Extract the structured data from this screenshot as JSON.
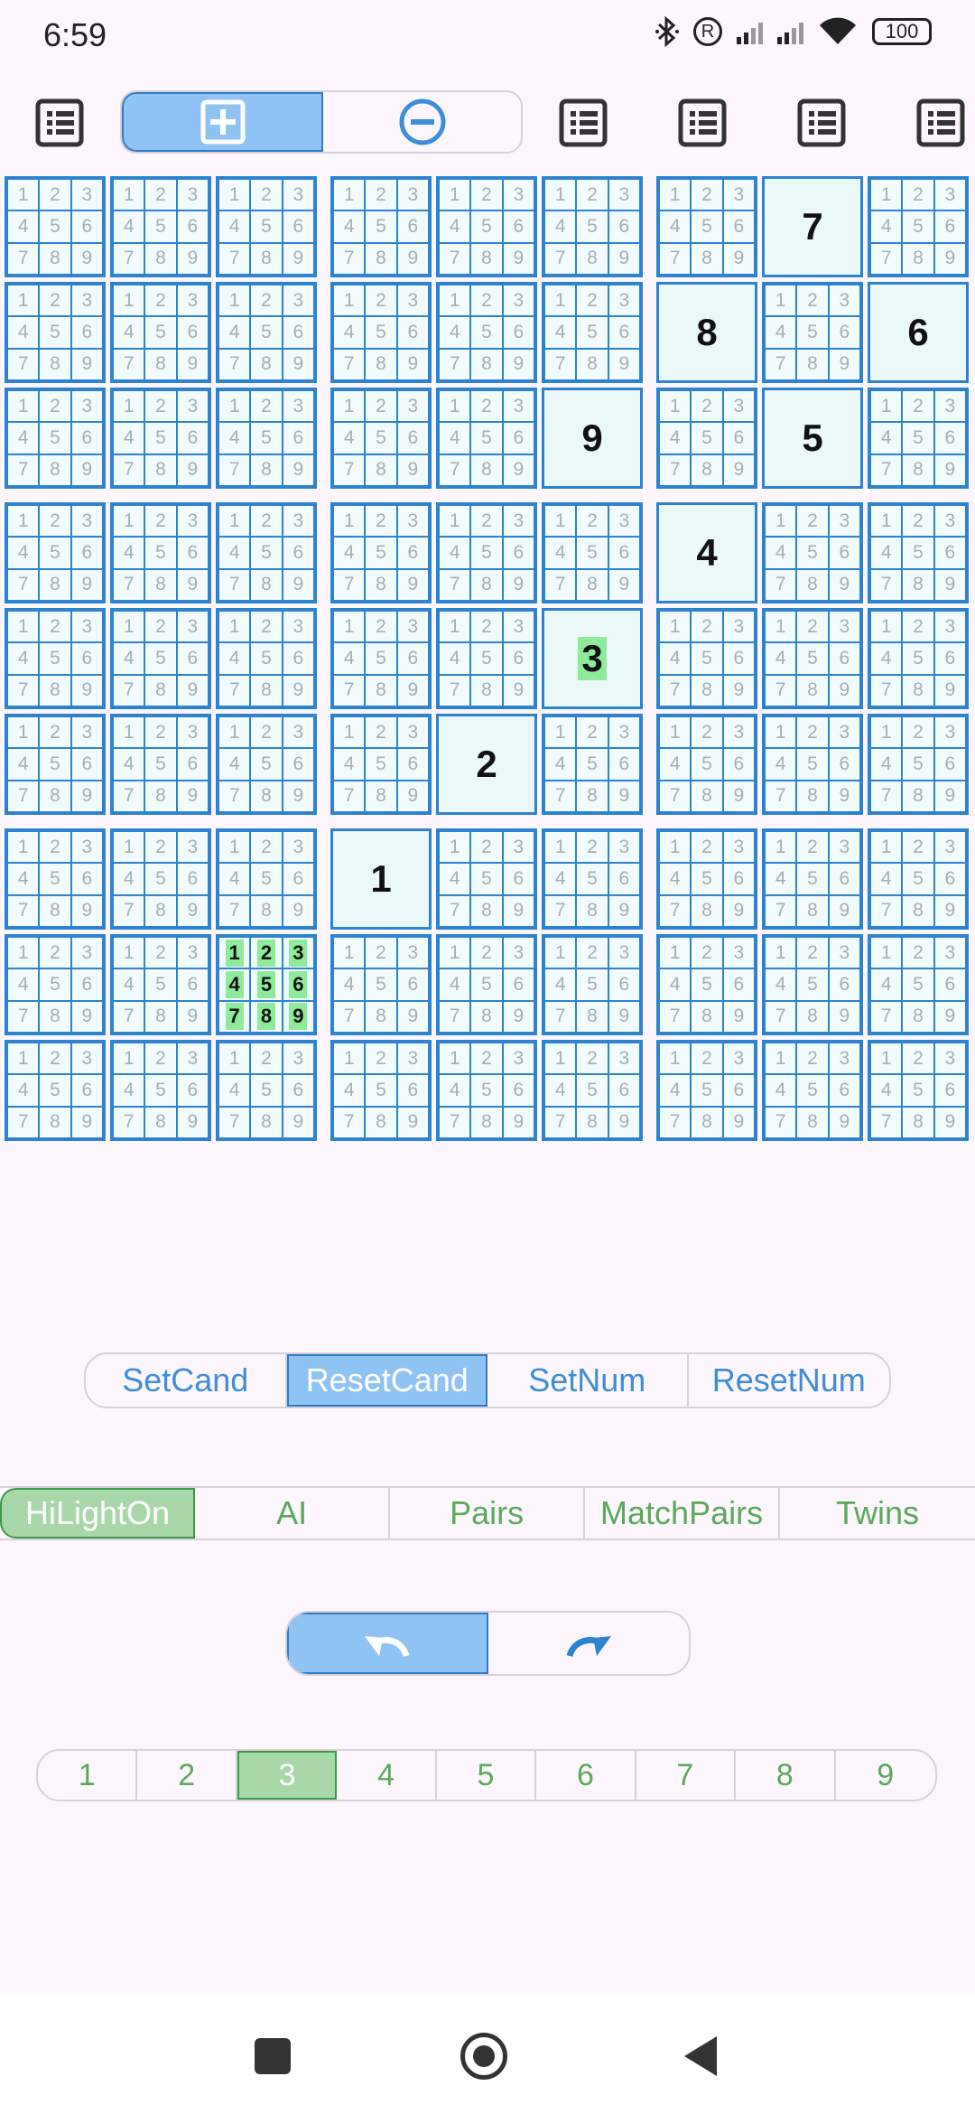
{
  "status": {
    "time": "6:59",
    "battery": "100",
    "registered": "R"
  },
  "toolbar": {
    "icons": [
      "list-icon",
      "add-box-icon",
      "remove-circle-icon",
      "list-icon",
      "list-icon",
      "list-icon",
      "list-icon"
    ],
    "colors": {
      "selected_blue": "#8fc3f3",
      "icon_dark": "#333333",
      "icon_blue": "#2c83cf"
    }
  },
  "grid": {
    "candidate_digits": [
      "1",
      "2",
      "3",
      "4",
      "5",
      "6",
      "7",
      "8",
      "9"
    ],
    "placed": [
      {
        "row": 0,
        "col": 7,
        "value": "7"
      },
      {
        "row": 1,
        "col": 6,
        "value": "8"
      },
      {
        "row": 1,
        "col": 8,
        "value": "6"
      },
      {
        "row": 2,
        "col": 5,
        "value": "9"
      },
      {
        "row": 2,
        "col": 7,
        "value": "5"
      },
      {
        "row": 3,
        "col": 6,
        "value": "4"
      },
      {
        "row": 4,
        "col": 5,
        "value": "3",
        "highlighted": true
      },
      {
        "row": 5,
        "col": 4,
        "value": "2"
      },
      {
        "row": 6,
        "col": 3,
        "value": "1"
      }
    ],
    "highlighted_candidate_cell": {
      "row": 7,
      "col": 2
    },
    "colors": {
      "border": "#2c83cf",
      "highlight": "#8deb9a",
      "cell_bg": "#f2fbfd"
    }
  },
  "cand_controls": {
    "items": [
      "SetCand",
      "ResetCand",
      "SetNum",
      "ResetNum"
    ],
    "selected": "ResetCand"
  },
  "mode_controls": {
    "items": [
      "HiLightOn",
      "AI",
      "Pairs",
      "MatchPairs",
      "Twins"
    ],
    "selected": "HiLightOn"
  },
  "history": {
    "undo_icon": "undo-icon",
    "redo_icon": "redo-icon",
    "selected": "undo"
  },
  "numbers": {
    "items": [
      "1",
      "2",
      "3",
      "4",
      "5",
      "6",
      "7",
      "8",
      "9"
    ],
    "selected": "3"
  },
  "navbar": {
    "icons": [
      "recents-icon",
      "home-icon",
      "back-icon"
    ]
  }
}
